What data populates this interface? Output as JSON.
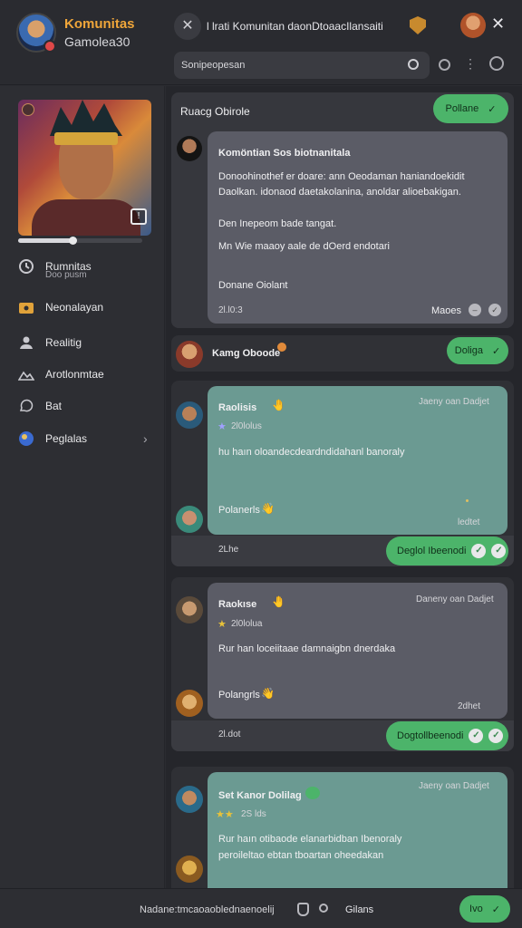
{
  "header": {
    "brand_title": "Komunitas",
    "brand_subtitle": "Gamolea30",
    "conversation_title": "l lrati Komunitan daonDtoaacIlansaiti",
    "search_placeholder": "Sonipeopesan"
  },
  "sidebar": {
    "progress": 0.45,
    "items": [
      {
        "label": "Rumnitas",
        "sub": "Doo pusm",
        "icon": "clock-icon"
      },
      {
        "label": "Neonalayan",
        "icon": "folder-icon"
      },
      {
        "label": "Realitig",
        "icon": "user-icon"
      },
      {
        "label": "Arotlonmtae",
        "icon": "mountain-icon"
      },
      {
        "label": "Bat",
        "icon": "chat-icon"
      },
      {
        "label": "Peglalas",
        "icon": "globe-icon"
      }
    ]
  },
  "chat": {
    "section1": {
      "title": "Ruacg Obirole",
      "button": "Pollane",
      "message": {
        "title": "Komöntian Sos biotnanitala",
        "line1": "Donoohinothef er doare: ann Oeodaman haniandoekidit",
        "line2": "Daolkan. idonaod daetakolanina, anoldar alioebakigan.",
        "line3": "Den Inepeom bade tangat.",
        "line4": "Mn Wie maaoy aale de dOerd endotari",
        "line5": "Donane Oiolant",
        "time": "2l.l0:3",
        "status": "Maoes"
      }
    },
    "section2": {
      "title": "Kamg Oboode",
      "button": "Doliga"
    },
    "post1": {
      "author": "Raolisis",
      "rating": "2l0lolus",
      "body": "hu haın oloandecdeardndidahanl banoraly",
      "footer_name": "Polanerls",
      "corner_label": "Jaeny oan Dadjet",
      "time_small": "ledtet",
      "time": "2Lhe",
      "button": "Deglol Ibeenodi"
    },
    "post2": {
      "author": "Raokıse",
      "rating": "2l0lolua",
      "body": "Rur han loceiitaae damnaigbn dnerdaka",
      "footer_name": "Polangrls",
      "corner_label": "Daneny oan Dadjet",
      "time_small": "2dhet",
      "time": "2l.dot",
      "button": "Dogtollbeenodi"
    },
    "post3": {
      "author": "Set Kanor Dolilag",
      "rating": "2S lds",
      "body_line1": "Rur haın otibaode elanarbidban Ibenoraly",
      "body_line2": "peroileltao ebtan tboartan oheedakan",
      "corner_label": "Jaeny oan Dadjet"
    }
  },
  "footer": {
    "input_text": "Nadane:tmcaoaoblednaenoelij",
    "label": "Gilans",
    "send_button": "Ivo"
  }
}
